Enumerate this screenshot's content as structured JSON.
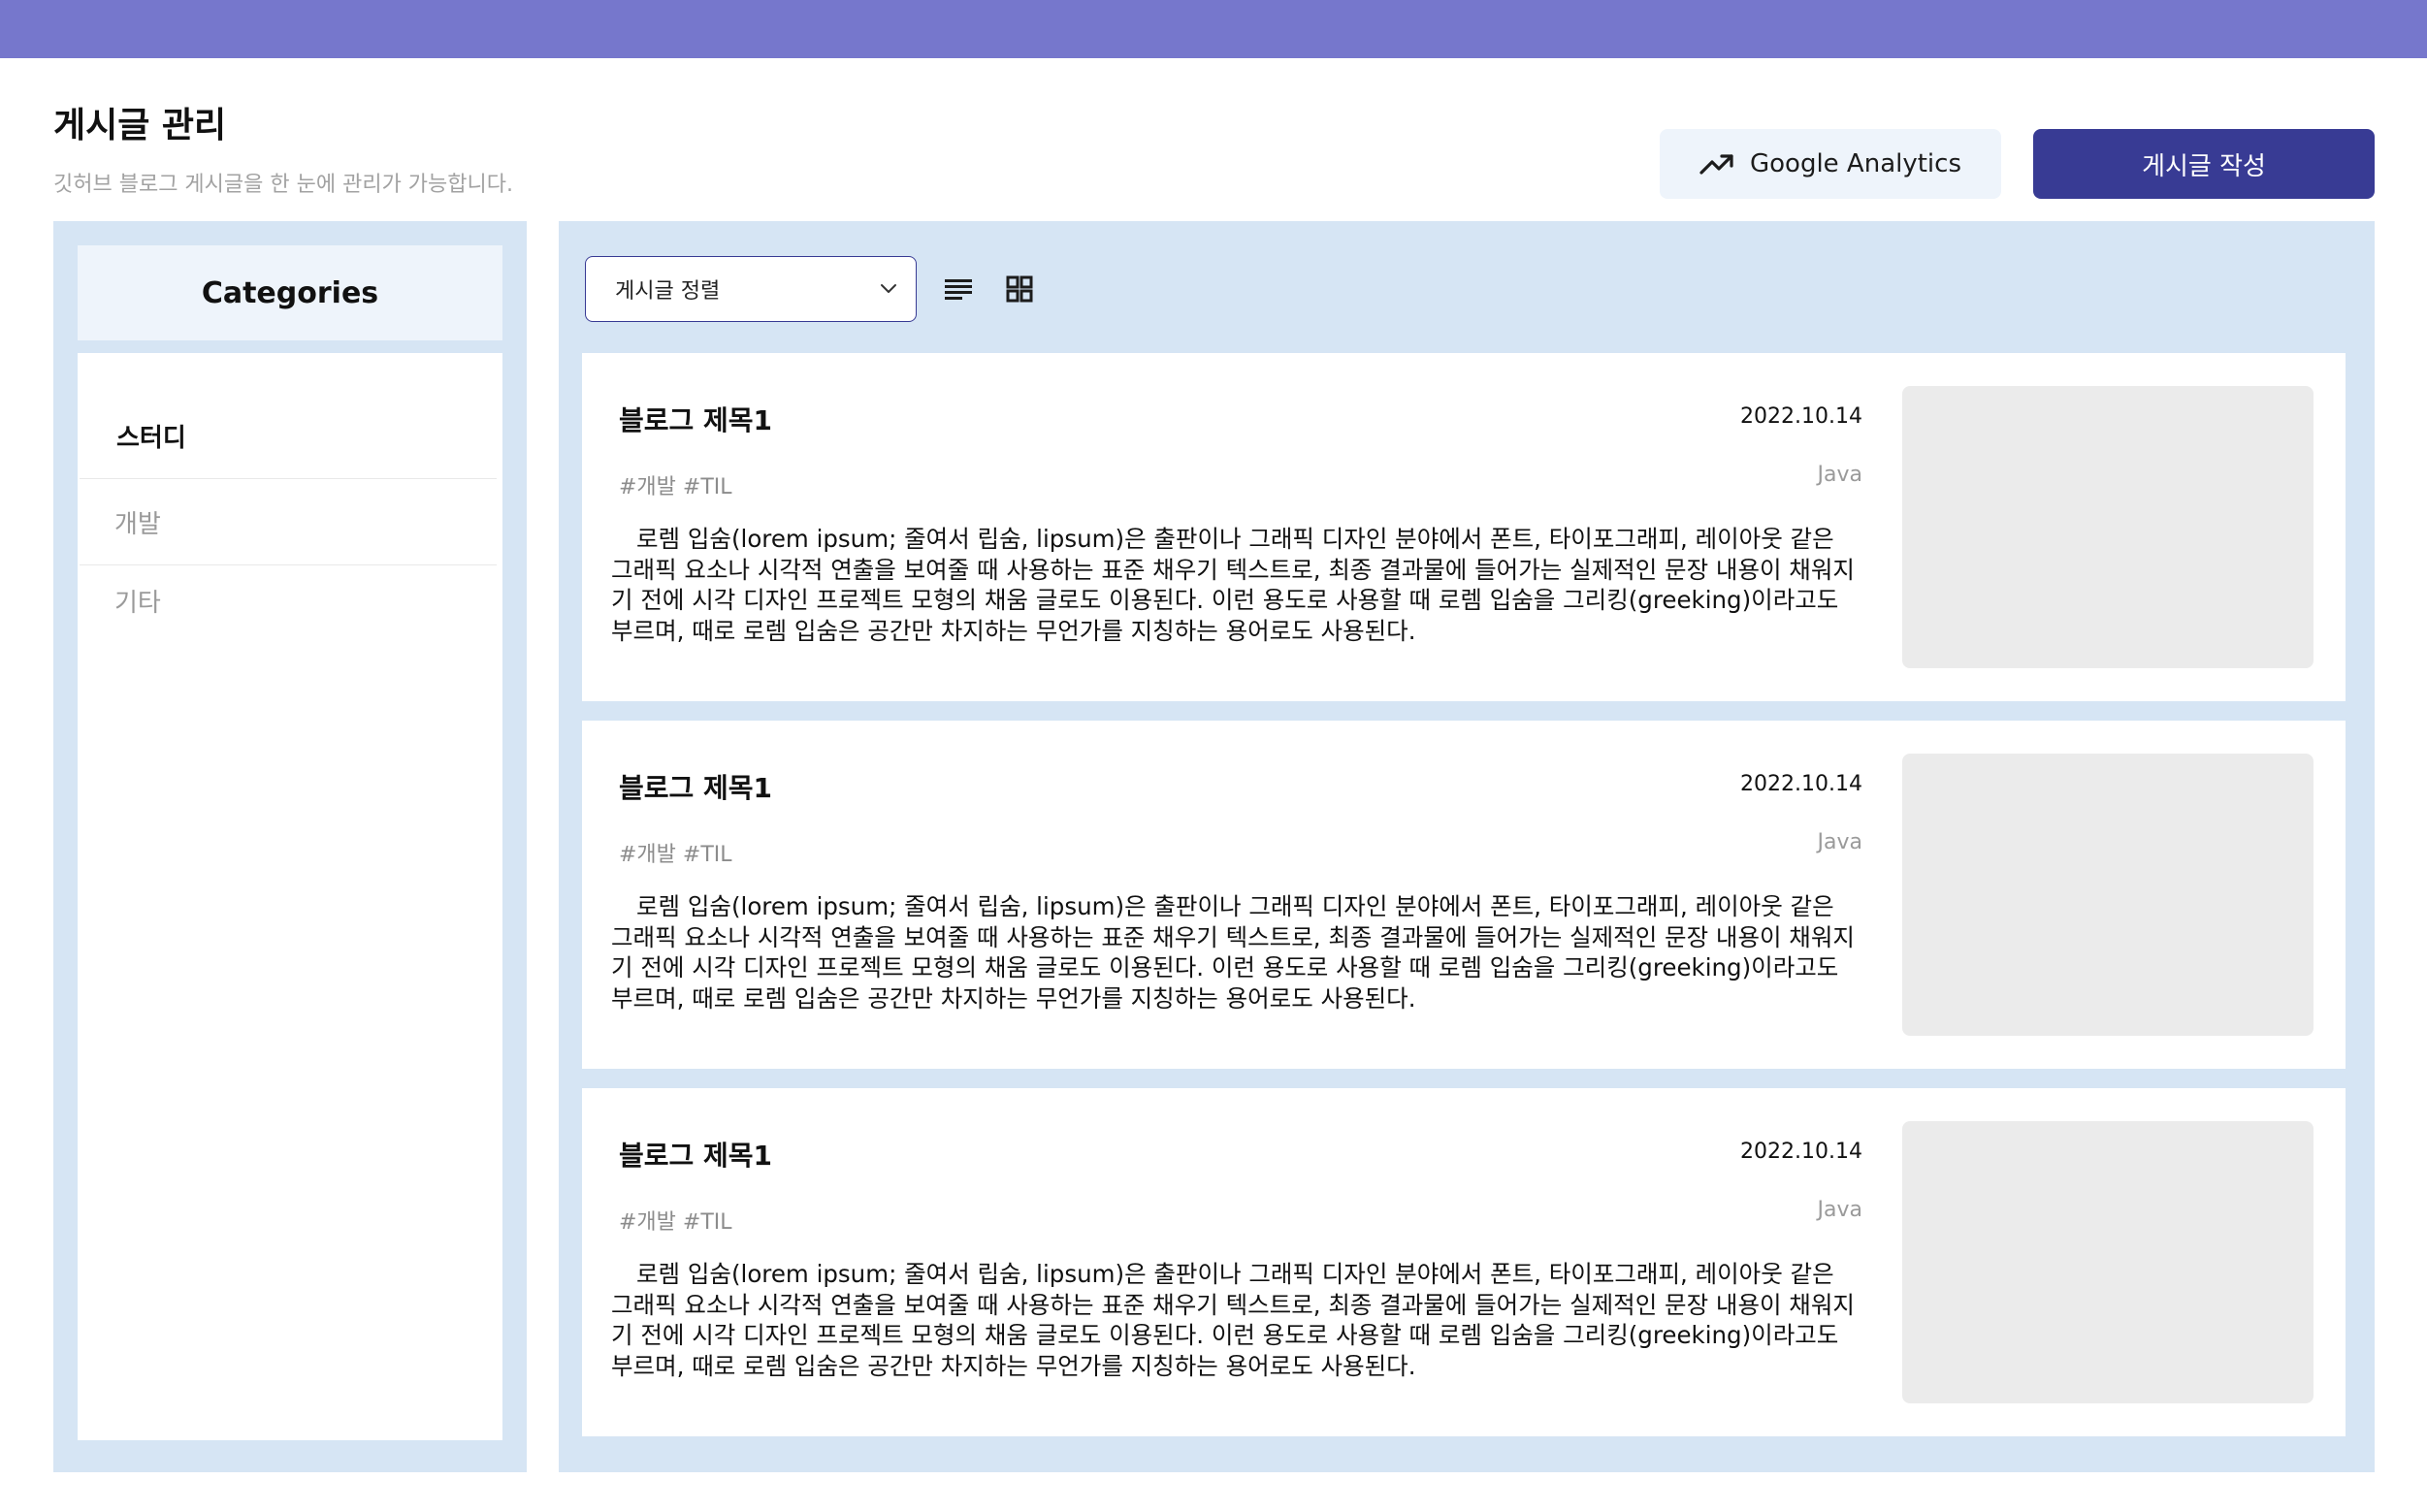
{
  "colors": {
    "topbar": "#7677cc",
    "primary_button": "#383b94",
    "panel_background": "#d6e5f4",
    "light_background": "#eef4fb",
    "thumbnail_placeholder": "#ebebeb"
  },
  "header": {
    "title": "게시글 관리",
    "subtitle": "깃허브 블로그 게시글을 한 눈에 관리가 가능합니다.",
    "analytics_button": {
      "icon": "trending-up-icon",
      "label": "Google Analytics"
    },
    "write_button": {
      "label": "게시글 작성"
    }
  },
  "sidebar": {
    "title": "Categories",
    "categories": [
      {
        "label": "스터디",
        "active": true
      },
      {
        "label": "개발",
        "active": false
      },
      {
        "label": "기타",
        "active": false
      }
    ]
  },
  "toolbar": {
    "sort_select": {
      "value": "게시글 정렬",
      "icon": "chevron-down-icon"
    },
    "view_icons": [
      "list-view-icon",
      "grid-view-icon"
    ]
  },
  "posts": [
    {
      "title": "블로그 제목1",
      "date": "2022.10.14",
      "tags": "#개발 #TIL",
      "category": "Java",
      "body": "로렘 입숨(lorem ipsum; 줄여서 립숨, lipsum)은 출판이나 그래픽 디자인 분야에서 폰트, 타이포그래피, 레이아웃 같은 그래픽 요소나 시각적 연출을 보여줄 때 사용하는 표준 채우기 텍스트로, 최종 결과물에 들어가는 실제적인 문장 내용이 채워지기 전에 시각 디자인 프로젝트 모형의 채움 글로도 이용된다. 이런 용도로 사용할 때 로렘 입숨을 그리킹(greeking)이라고도 부르며, 때로 로렘 입숨은 공간만 차지하는 무언가를 지칭하는 용어로도 사용된다."
    },
    {
      "title": "블로그 제목1",
      "date": "2022.10.14",
      "tags": "#개발 #TIL",
      "category": "Java",
      "body": "로렘 입숨(lorem ipsum; 줄여서 립숨, lipsum)은 출판이나 그래픽 디자인 분야에서 폰트, 타이포그래피, 레이아웃 같은 그래픽 요소나 시각적 연출을 보여줄 때 사용하는 표준 채우기 텍스트로, 최종 결과물에 들어가는 실제적인 문장 내용이 채워지기 전에 시각 디자인 프로젝트 모형의 채움 글로도 이용된다. 이런 용도로 사용할 때 로렘 입숨을 그리킹(greeking)이라고도 부르며, 때로 로렘 입숨은 공간만 차지하는 무언가를 지칭하는 용어로도 사용된다."
    },
    {
      "title": "블로그 제목1",
      "date": "2022.10.14",
      "tags": "#개발 #TIL",
      "category": "Java",
      "body": "로렘 입숨(lorem ipsum; 줄여서 립숨, lipsum)은 출판이나 그래픽 디자인 분야에서 폰트, 타이포그래피, 레이아웃 같은 그래픽 요소나 시각적 연출을 보여줄 때 사용하는 표준 채우기 텍스트로, 최종 결과물에 들어가는 실제적인 문장 내용이 채워지기 전에 시각 디자인 프로젝트 모형의 채움 글로도 이용된다. 이런 용도로 사용할 때 로렘 입숨을 그리킹(greeking)이라고도 부르며, 때로 로렘 입숨은 공간만 차지하는 무언가를 지칭하는 용어로도 사용된다."
    }
  ]
}
